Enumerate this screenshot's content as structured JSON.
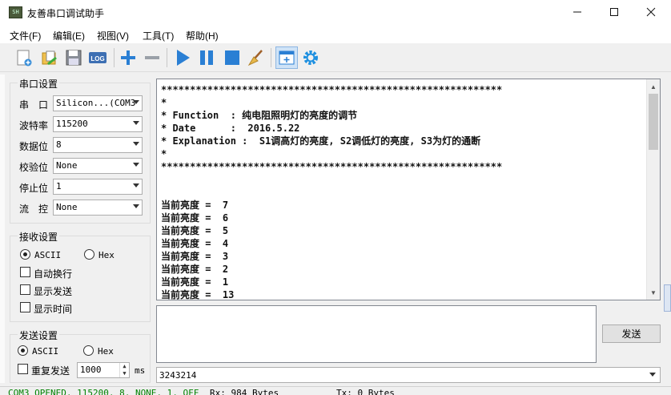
{
  "window": {
    "title": "友善串口调试助手",
    "app_icon_text": "SH"
  },
  "menu": [
    "文件(F)",
    "编辑(E)",
    "视图(V)",
    "工具(T)",
    "帮助(H)"
  ],
  "toolbar": {
    "icons": [
      "new-file-icon",
      "open-folder-icon",
      "save-icon",
      "log-icon",
      "add-icon",
      "remove-icon",
      "play-icon",
      "pause-icon",
      "stop-icon",
      "broom-clear-icon",
      "add-window-icon",
      "settings-gear-icon"
    ],
    "log_label": "LOG"
  },
  "serial_settings": {
    "group_label": "串口设置",
    "fields": [
      {
        "label": "串　口",
        "value": "Silicon...(COM3"
      },
      {
        "label": "波特率",
        "value": "115200"
      },
      {
        "label": "数据位",
        "value": "8"
      },
      {
        "label": "校验位",
        "value": "None"
      },
      {
        "label": "停止位",
        "value": "1"
      },
      {
        "label": "流　控",
        "value": "None"
      }
    ]
  },
  "receive_settings": {
    "group_label": "接收设置",
    "ascii_label": "ASCII",
    "hex_label": "Hex",
    "mode_selected": "ASCII",
    "options": [
      {
        "label": "自动换行",
        "checked": false
      },
      {
        "label": "显示发送",
        "checked": false
      },
      {
        "label": "显示时间",
        "checked": false
      }
    ]
  },
  "send_settings": {
    "group_label": "发送设置",
    "ascii_label": "ASCII",
    "hex_label": "Hex",
    "mode_selected": "ASCII",
    "repeat_label": "重复发送",
    "repeat_checked": false,
    "interval_value": "1000",
    "interval_unit": "ms"
  },
  "receive_area": {
    "lines": [
      "***********************************************************",
      "*",
      "* Function  : 纯电阻照明灯的亮度的调节",
      "* Date      :  2016.5.22",
      "* Explanation :  S1调高灯的亮度, S2调低灯的亮度, S3为灯的通断",
      "*",
      "***********************************************************",
      "",
      "",
      "当前亮度 =  7",
      "当前亮度 =  6",
      "当前亮度 =  5",
      "当前亮度 =  4",
      "当前亮度 =  3",
      "当前亮度 =  2",
      "当前亮度 =  1",
      "当前亮度 =  13"
    ]
  },
  "send_area": {
    "text": "",
    "send_button": "发送",
    "history_value": "3243214"
  },
  "status": {
    "port_state": "COM3 OPENED, 115200, 8, NONE, 1, OFF",
    "rx": "Rx: 984 Bytes",
    "tx": "Tx: 0 Bytes",
    "port_state_color": "#008000"
  }
}
